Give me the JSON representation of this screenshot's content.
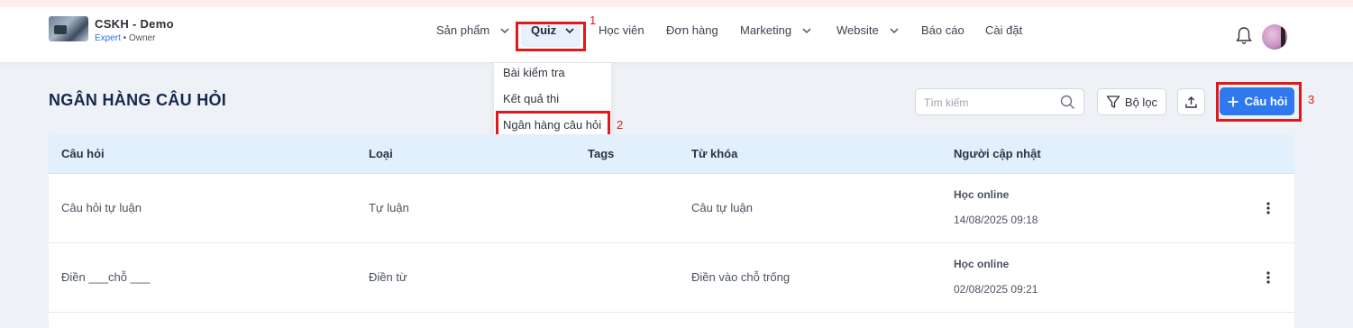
{
  "brand": {
    "title": "CSKH - Demo",
    "tier": "Expert",
    "separator": " • ",
    "role": "Owner"
  },
  "nav": {
    "items": [
      {
        "label": "Sản phẩm"
      },
      {
        "label": "Quiz"
      },
      {
        "label": "Học viên"
      },
      {
        "label": "Đơn hàng"
      },
      {
        "label": "Marketing"
      },
      {
        "label": "Website"
      },
      {
        "label": "Báo cáo"
      },
      {
        "label": "Cài đặt"
      }
    ]
  },
  "dropdown": {
    "items": [
      "Bài kiểm tra",
      "Kết quả thi",
      "Ngân hàng câu hỏi"
    ]
  },
  "annotations": [
    "1",
    "2",
    "3"
  ],
  "page": {
    "title": "NGÂN HÀNG CÂU HỎI"
  },
  "toolbar": {
    "search_placeholder": "Tìm kiếm",
    "filter_label": "Bộ lọc",
    "add_label": "Câu hỏi"
  },
  "table": {
    "columns": [
      "Câu hỏi",
      "Loại",
      "Tags",
      "Từ khóa",
      "Người cập nhật"
    ],
    "rows": [
      {
        "question": "Câu hỏi tự luận",
        "type": "Tự luận",
        "tags": "",
        "keyword": "Câu tự luận",
        "updated_by": "Học online",
        "updated_at": "14/08/2025 09:18"
      },
      {
        "question": "Điền ___chỗ ___",
        "type": "Điền từ",
        "tags": "",
        "keyword": "Điền vào chỗ trống",
        "updated_by": "Học online",
        "updated_at": "02/08/2025 09:21"
      }
    ]
  },
  "colors": {
    "accent": "#2e78f0",
    "highlight": "#e11919",
    "title": "#15294d",
    "header_bg": "#e2effc"
  },
  "icons": [
    "bell-icon",
    "search-icon",
    "filter-icon",
    "upload-icon",
    "plus-icon",
    "chevron-down-icon",
    "kebab-icon"
  ]
}
